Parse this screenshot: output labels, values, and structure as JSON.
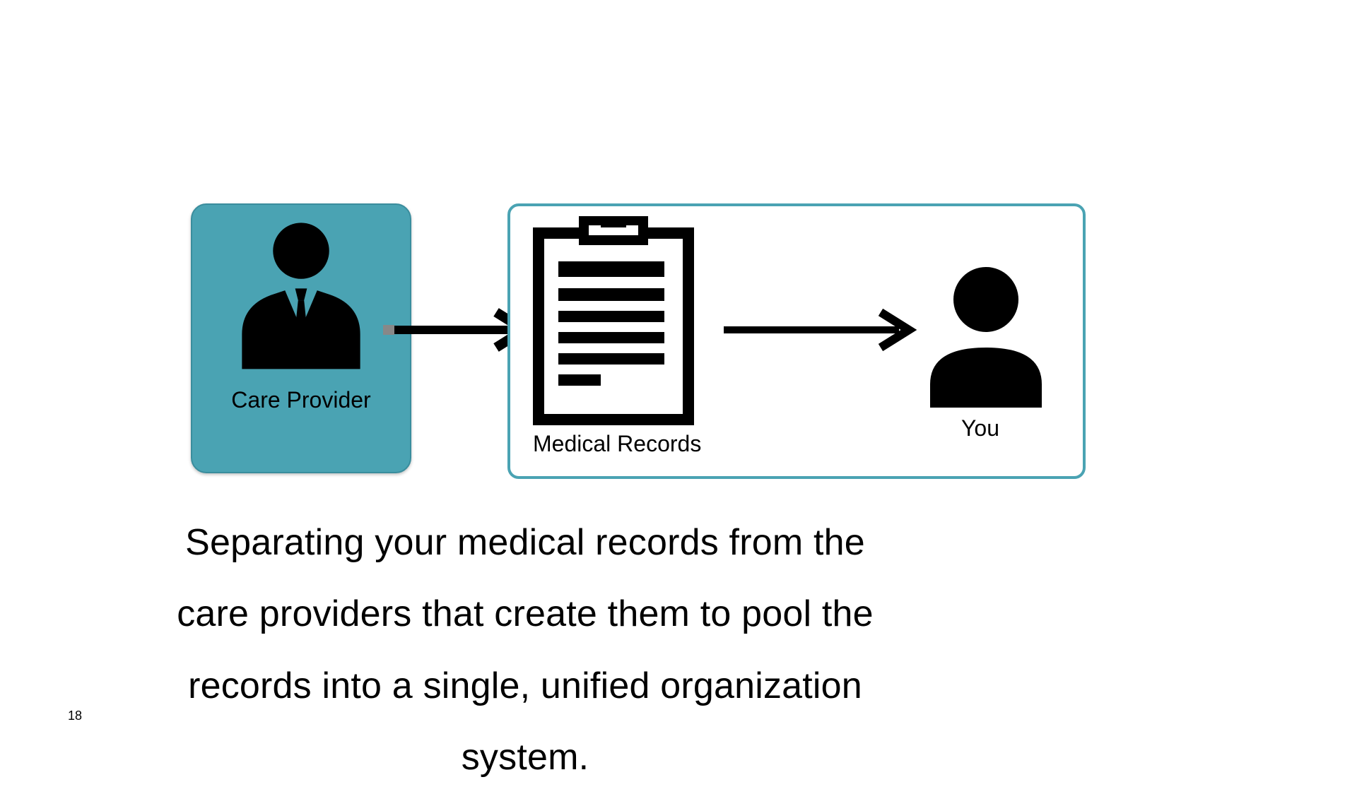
{
  "diagram": {
    "care_provider_label": "Care Provider",
    "medical_records_label": "Medical Records",
    "you_label": "You"
  },
  "caption": "Separating your medical records from the care providers that create them to pool the records into a single, unified organization system.",
  "page_number": "18",
  "colors": {
    "teal": "#4aa3b3",
    "teal_border": "#3a8d9d",
    "black": "#000000",
    "white": "#ffffff"
  }
}
